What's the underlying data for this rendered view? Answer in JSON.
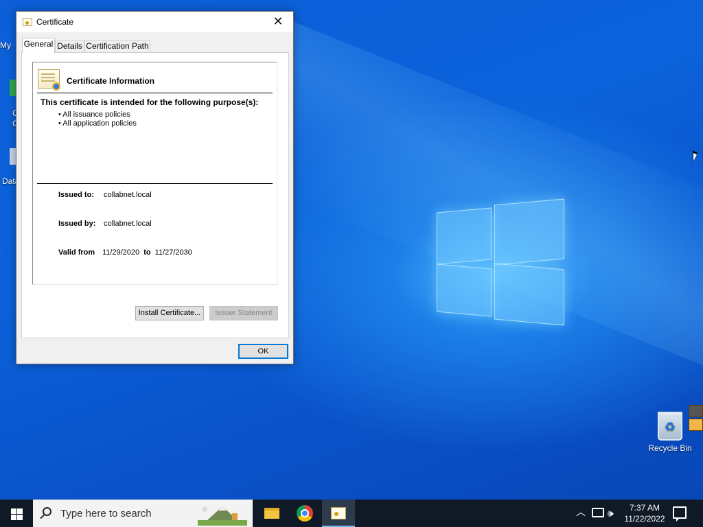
{
  "dialog": {
    "title": "Certificate",
    "close_glyph": "✕",
    "tabs": [
      {
        "label": "General",
        "active": true
      },
      {
        "label": "Details",
        "active": false
      },
      {
        "label": "Certification Path",
        "active": false
      }
    ],
    "info_heading": "Certificate Information",
    "purpose_title": "This certificate is intended for the following purpose(s):",
    "purposes": [
      "• All issuance policies",
      "• All application policies"
    ],
    "issued_to_label": "Issued to:",
    "issued_to_value": "collabnet.local",
    "issued_by_label": "Issued by:",
    "issued_by_value": "collabnet.local",
    "valid_from_label": "Valid from",
    "valid_from_value": "11/29/2020",
    "valid_to_label": "to",
    "valid_to_value": "11/27/2030",
    "install_button": "Install Certificate...",
    "issuer_statement_button": "Issuer Statement",
    "ok_button": "OK"
  },
  "desktop": {
    "recycle_bin_label": "Recycle Bin",
    "partial_labels": [
      "My",
      "C",
      "C",
      "Data"
    ]
  },
  "taskbar": {
    "search_placeholder": "Type here to search",
    "clock_time": "7:37 AM",
    "clock_date": "11/22/2022",
    "tray_chevron": "︿",
    "tray_volume": "🕪",
    "accent_color": "#0078d7"
  },
  "icons": [
    "certificate-icon",
    "close-icon",
    "recycle-bin-icon",
    "windows-start-icon",
    "search-icon",
    "file-explorer-icon",
    "chrome-icon",
    "network-icon",
    "volume-icon",
    "notification-icon"
  ]
}
